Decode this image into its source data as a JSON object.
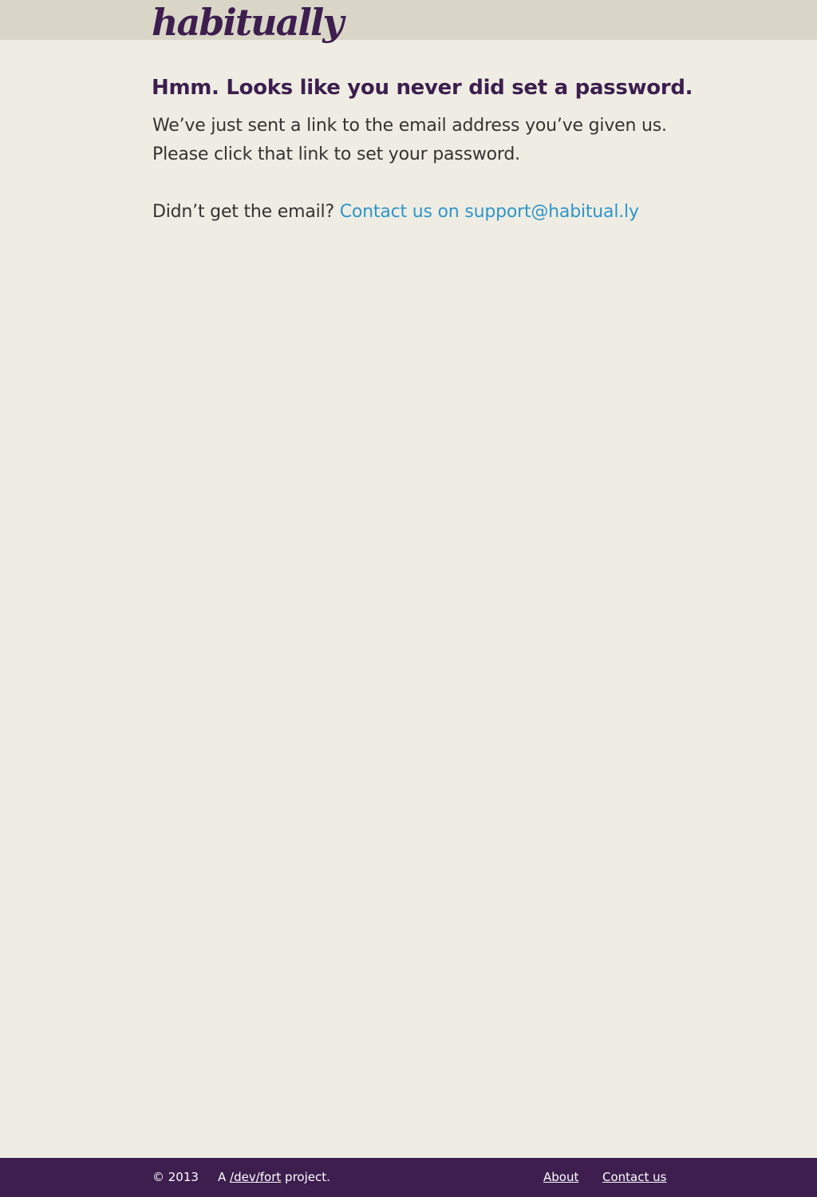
{
  "header": {
    "logo_text": "habitually"
  },
  "main": {
    "title": "Hmm. Looks like you never did set a password.",
    "line1": "We’ve just sent a link to the email address you’ve given us.",
    "line2": "Please click that link to set your password.",
    "help_prefix": "Didn’t get the email? ",
    "help_link": "Contact us on support@habitual.ly"
  },
  "footer": {
    "copyright": "© 2013",
    "project_prefix": "A ",
    "project_link": "/dev/fort",
    "project_suffix": " project.",
    "about_link": "About",
    "contact_link": "Contact us"
  },
  "colors": {
    "background": "#efede3",
    "header_bar": "#d9d6c8",
    "brand_purple": "#3d1e4f",
    "link_blue": "#2f95c9",
    "body_text": "#333333"
  }
}
